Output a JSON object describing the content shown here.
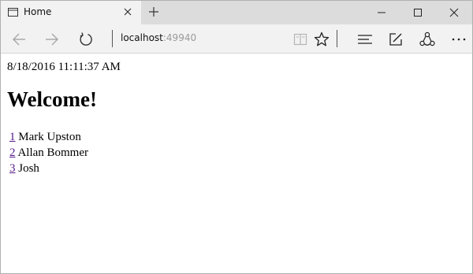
{
  "browser": {
    "tab": {
      "title": "Home"
    },
    "address": {
      "host": "localhost",
      "port": ":49940"
    },
    "icons": {
      "tab": "page-icon",
      "close": "close-icon",
      "new_tab": "plus-icon",
      "back": "back-arrow-icon",
      "forward": "forward-arrow-icon",
      "refresh": "refresh-icon",
      "reading_view": "book-icon",
      "favorite": "star-icon",
      "hub": "hub-lines-icon",
      "notes": "pen-note-icon",
      "share": "share-icon",
      "more": "ellipsis-icon"
    }
  },
  "page": {
    "timestamp": "8/18/2016 11:11:37 AM",
    "heading": "Welcome!",
    "people": [
      {
        "id": "1",
        "name": "Mark Upston"
      },
      {
        "id": "2",
        "name": "Allan Bommer"
      },
      {
        "id": "3",
        "name": "Josh"
      }
    ]
  },
  "colors": {
    "titlebar": "#dcdcdc",
    "toolbar": "#f2f2f2",
    "link_visited": "#551a8b"
  }
}
